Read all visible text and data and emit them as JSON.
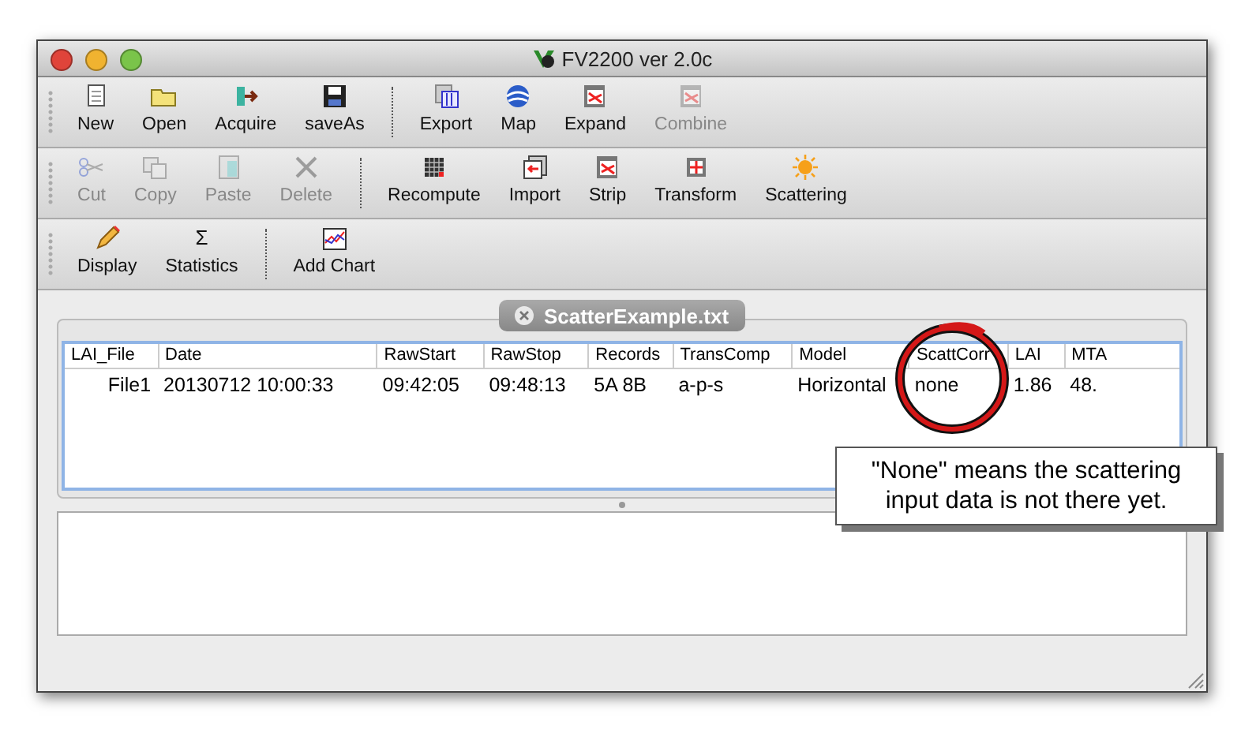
{
  "window": {
    "title": "FV2200 ver 2.0c"
  },
  "toolbars": [
    {
      "groups": [
        [
          {
            "label": "New",
            "disabled": false
          },
          {
            "label": "Open",
            "disabled": false
          },
          {
            "label": "Acquire",
            "disabled": false
          },
          {
            "label": "saveAs",
            "disabled": false
          }
        ],
        [
          {
            "label": "Export",
            "disabled": false
          },
          {
            "label": "Map",
            "disabled": false
          },
          {
            "label": "Expand",
            "disabled": false
          },
          {
            "label": "Combine",
            "disabled": true
          }
        ]
      ]
    },
    {
      "groups": [
        [
          {
            "label": "Cut",
            "disabled": true
          },
          {
            "label": "Copy",
            "disabled": true
          },
          {
            "label": "Paste",
            "disabled": true
          },
          {
            "label": "Delete",
            "disabled": true
          }
        ],
        [
          {
            "label": "Recompute",
            "disabled": false
          },
          {
            "label": "Import",
            "disabled": false
          },
          {
            "label": "Strip",
            "disabled": false
          },
          {
            "label": "Transform",
            "disabled": false
          },
          {
            "label": "Scattering",
            "disabled": false
          }
        ]
      ]
    },
    {
      "groups": [
        [
          {
            "label": "Display",
            "disabled": false
          },
          {
            "label": "Statistics",
            "disabled": false,
            "glyph": "Σ"
          }
        ],
        [
          {
            "label": "Add Chart",
            "disabled": false
          }
        ]
      ]
    }
  ],
  "document_tab": {
    "label": "ScatterExample.txt"
  },
  "table": {
    "columns": [
      "LAI_File",
      "Date",
      "RawStart",
      "RawStop",
      "Records",
      "TransComp",
      "Model",
      "ScattCorr",
      "LAI",
      "MTA"
    ],
    "rows": [
      [
        "File1",
        "20130712 10:00:33",
        "09:42:05",
        "09:48:13",
        "5A 8B",
        "a-p-s",
        "Horizontal",
        "none",
        "1.86",
        "48."
      ]
    ]
  },
  "callout": {
    "text": "\"None\" means the scattering input data is not there yet."
  }
}
